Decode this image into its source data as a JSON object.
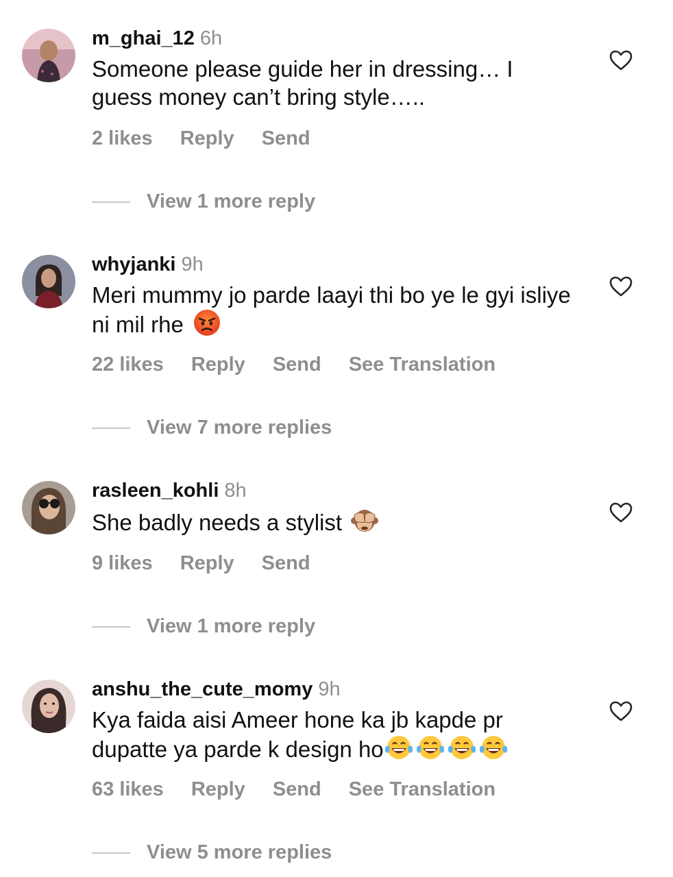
{
  "comments": [
    {
      "username": "m_ghai_12",
      "time": "6h",
      "text": "Someone please guide her in dressing… I guess money can’t bring  style…..",
      "likes": "2 likes",
      "reply": "Reply",
      "send": "Send",
      "view_replies": "View 1 more reply"
    },
    {
      "username": "whyjanki",
      "time": "9h",
      "text": "Meri mummy jo parde laayi thi bo ye le gyi isliye ni mil rhe",
      "emoji": "angry-face",
      "likes": "22 likes",
      "reply": "Reply",
      "send": "Send",
      "translate": "See Translation",
      "view_replies": "View 7 more replies"
    },
    {
      "username": "rasleen_kohli",
      "time": "8h",
      "text": "She badly needs a stylist",
      "emoji": "see-no-evil-monkey",
      "likes": "9 likes",
      "reply": "Reply",
      "send": "Send",
      "view_replies": "View 1 more reply"
    },
    {
      "username": "anshu_the_cute_momy",
      "time": "9h",
      "text": "Kya faida aisi Ameer hone ka jb kapde pr dupatte ya parde k design ho",
      "emoji": "tears-of-joy x4",
      "likes": "63 likes",
      "reply": "Reply",
      "send": "Send",
      "translate": "See Translation",
      "view_replies": "View 5 more replies"
    }
  ],
  "icons": {
    "like": "heart-outline-icon"
  },
  "colors": {
    "text": "#111111",
    "muted": "#8e8e8e"
  }
}
